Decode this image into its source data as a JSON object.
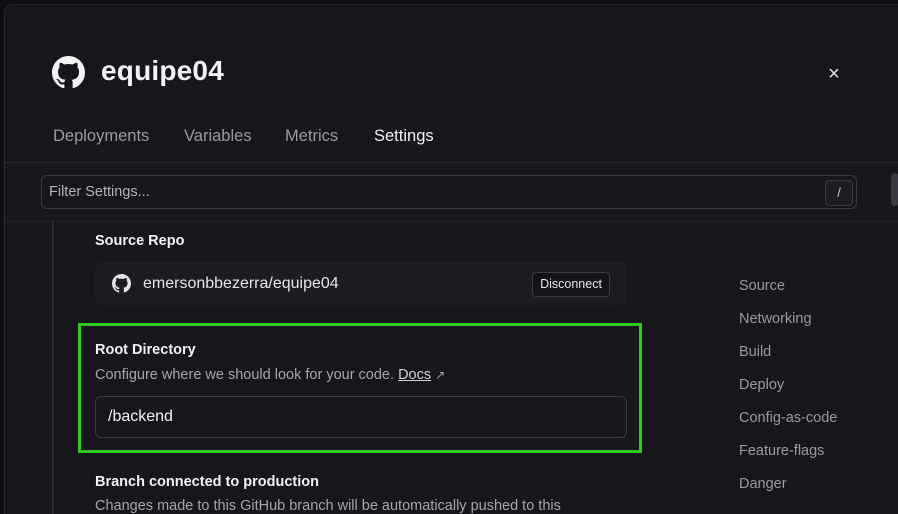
{
  "header": {
    "title": "equipe04",
    "close_glyph": "×",
    "logo_icon": "github-icon"
  },
  "tabs": [
    {
      "label": "Deployments",
      "active": false
    },
    {
      "label": "Variables",
      "active": false
    },
    {
      "label": "Metrics",
      "active": false
    },
    {
      "label": "Settings",
      "active": true
    }
  ],
  "filter": {
    "placeholder": "Filter Settings...",
    "shortcut": "/"
  },
  "source_repo": {
    "title": "Source Repo",
    "repo": "emersonbbezerra/equipe04",
    "disconnect_label": "Disconnect"
  },
  "root_directory": {
    "title": "Root Directory",
    "description": "Configure where we should look for your code.",
    "docs_label": "Docs",
    "docs_arrow": "↗",
    "value": "/backend"
  },
  "branch": {
    "title": "Branch connected to production",
    "description": "Changes made to this GitHub branch will be automatically pushed to this"
  },
  "side_nav": [
    "Source",
    "Networking",
    "Build",
    "Deploy",
    "Config-as-code",
    "Feature-flags",
    "Danger"
  ],
  "colors": {
    "highlight": "#2ecc1a",
    "background": "#17161c",
    "text_muted": "#9a99a3"
  }
}
